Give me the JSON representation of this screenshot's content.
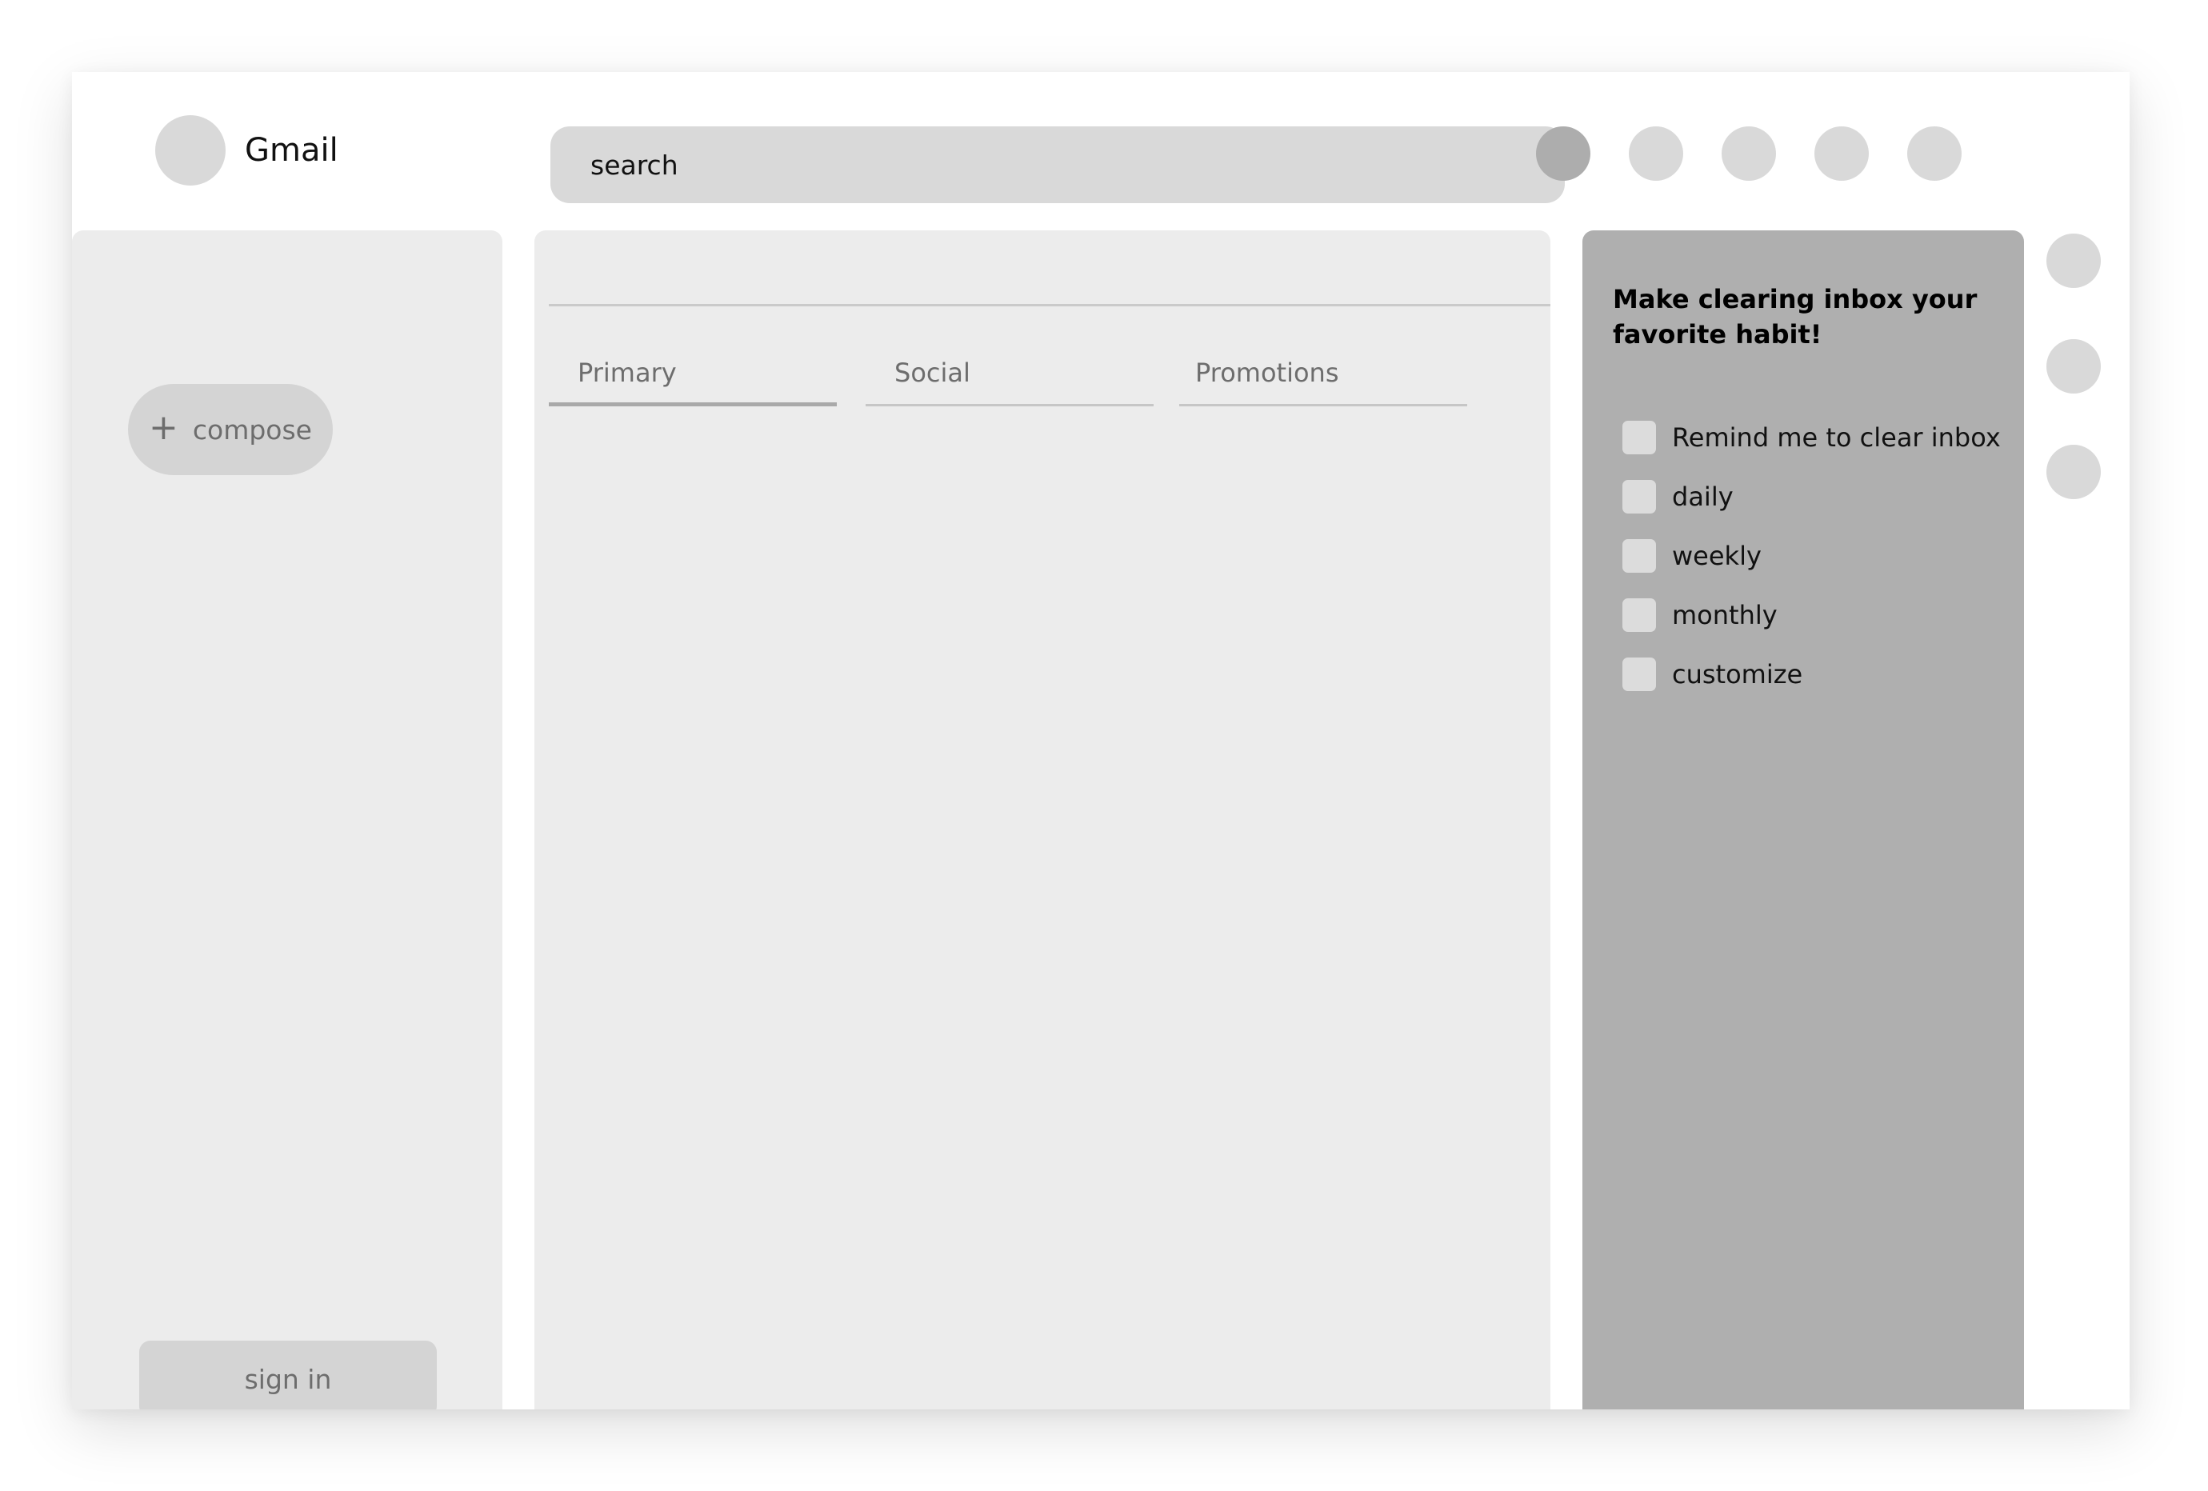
{
  "header": {
    "app_title": "Gmail",
    "search_placeholder": "search"
  },
  "sidebar": {
    "compose_icon": "+",
    "compose_label": "compose",
    "signin_label": "sign in"
  },
  "main": {
    "tabs": [
      {
        "label": "Primary",
        "active": true
      },
      {
        "label": "Social",
        "active": false
      },
      {
        "label": "Promotions",
        "active": false
      }
    ]
  },
  "habit_panel": {
    "title": "Make clearing inbox your favorite habit!",
    "options": [
      {
        "label": "Remind me to clear inbox",
        "checked": false
      },
      {
        "label": "daily",
        "checked": false
      },
      {
        "label": "weekly",
        "checked": false
      },
      {
        "label": "monthly",
        "checked": false
      },
      {
        "label": "customize",
        "checked": false
      }
    ]
  },
  "icons": {
    "top_bar": [
      "account-icon",
      "apps-icon",
      "settings-icon",
      "help-icon",
      "support-icon"
    ],
    "side_rail": [
      "calendar-icon",
      "keep-icon",
      "tasks-icon"
    ]
  },
  "colors": {
    "panel": "#ececec",
    "habit_panel": "#afafaf",
    "placeholder_gray": "#d9d9d9",
    "accent_dark_circle": "#adadad"
  }
}
